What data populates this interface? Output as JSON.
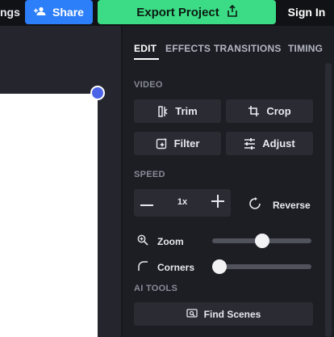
{
  "header": {
    "settings_partial": "ngs",
    "share_label": "Share",
    "export_label": "Export Project",
    "signin_label": "Sign In"
  },
  "tabs": [
    {
      "label": "EDIT",
      "active": true
    },
    {
      "label": "EFFECTS",
      "active": false
    },
    {
      "label": "TRANSITIONS",
      "active": false
    },
    {
      "label": "TIMING",
      "active": false
    }
  ],
  "video": {
    "section_label": "VIDEO",
    "trim_label": "Trim",
    "crop_label": "Crop",
    "filter_label": "Filter",
    "adjust_label": "Adjust"
  },
  "speed": {
    "section_label": "SPEED",
    "value": "1x",
    "reverse_label": "Reverse"
  },
  "zoom": {
    "label": "Zoom",
    "value_fraction": 0.5
  },
  "corners": {
    "label": "Corners",
    "value_fraction": 0.0
  },
  "ai_tools": {
    "section_label": "AI TOOLS",
    "find_scenes_label": "Find Scenes"
  },
  "colors": {
    "share": "#2d7ff9",
    "export": "#3bdc85",
    "panel": "#1d1e24",
    "canvas_handle": "#4b63e6"
  },
  "icons": [
    "add-user-icon",
    "upload-icon",
    "trim-icon",
    "crop-icon",
    "filter-icon",
    "adjust-icon",
    "minus-icon",
    "plus-icon",
    "reverse-icon",
    "zoom-icon",
    "corners-icon",
    "find-scenes-icon"
  ]
}
